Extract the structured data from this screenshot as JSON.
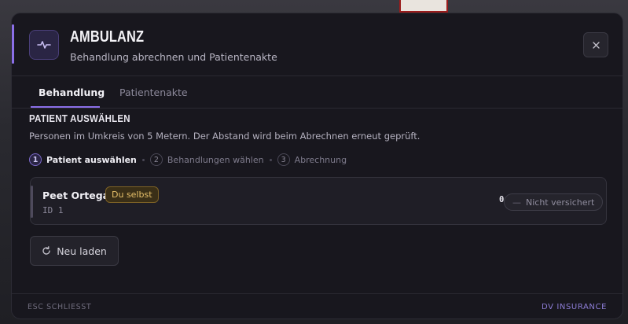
{
  "header": {
    "title": "AMBULANZ",
    "subtitle": "Behandlung abrechnen und Patientenakte",
    "icon": "heartbeat-icon",
    "close_icon": "close-icon"
  },
  "tabs": [
    {
      "label": "Behandlung",
      "active": true
    },
    {
      "label": "Patientenakte",
      "active": false
    }
  ],
  "section": {
    "title": "PATIENT AUSWÄHLEN",
    "description": "Personen im Umkreis von 5 Metern. Der Abstand wird beim Abrechnen erneut geprüft."
  },
  "steps": [
    {
      "number": "1",
      "label": "Patient auswählen",
      "active": true
    },
    {
      "number": "2",
      "label": "Behandlungen wählen",
      "active": false
    },
    {
      "number": "3",
      "label": "Abrechnung",
      "active": false
    }
  ],
  "patients": [
    {
      "name": "Peet Ortega",
      "badge": "Du selbst",
      "id": "ID 1",
      "coverage": "0 %",
      "insurance": "Nicht versichert",
      "insurance_icon": "dash-icon"
    }
  ],
  "reload": {
    "label": "Neu laden",
    "icon": "refresh-icon"
  },
  "footer": {
    "left": "ESC SCHLIESST",
    "right": "DV INSURANCE"
  },
  "colors": {
    "accent": "#8b6fe8",
    "panel_bg": "#18171e",
    "badge_gold": "#e7c06a"
  }
}
